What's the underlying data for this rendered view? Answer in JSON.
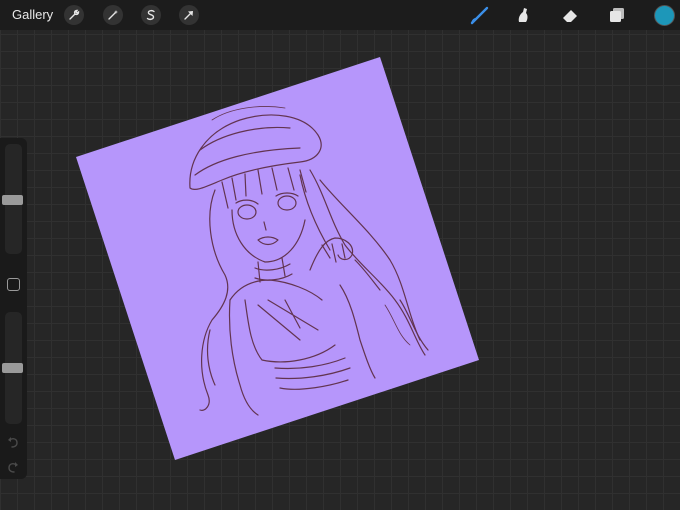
{
  "topbar": {
    "gallery_label": "Gallery",
    "left_tools": [
      "wrench-icon",
      "magic-wand-icon",
      "selection-s-icon",
      "transform-arrow-icon"
    ],
    "right_tools": [
      "brush-icon",
      "smudge-icon",
      "eraser-icon",
      "layers-icon"
    ],
    "active_tool": "brush-icon",
    "colors": {
      "active_tool": "#3b8fe8",
      "current_color": "#1d97b9",
      "tool_icon": "#e6e6e6"
    }
  },
  "sidebar": {
    "brush_size_level": 0.5,
    "opacity_level": 0.5,
    "controls": [
      "brush-size-slider",
      "modify-button",
      "opacity-slider",
      "undo-icon",
      "redo-icon"
    ]
  },
  "canvas": {
    "paper_color": "#b696fb",
    "sketch_color": "#5a2a3e",
    "background_color": "#262626"
  }
}
